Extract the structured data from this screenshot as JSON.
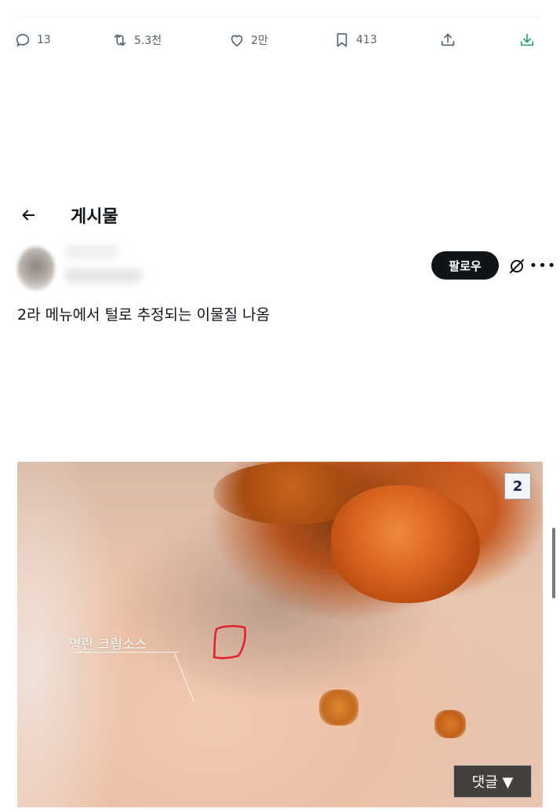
{
  "actions": {
    "reply_count": "13",
    "repost_count": "5.3천",
    "like_count": "2만",
    "bookmark_count": "413"
  },
  "header": {
    "title": "게시물"
  },
  "follow_label": "팔로우",
  "post": {
    "text": "2라 메뉴에서 털로 추정되는 이물질 나옴"
  },
  "image": {
    "badge": "2",
    "label": "명란 크림소스",
    "comment_button": "댓글 ▼"
  },
  "colors": {
    "follow_bg": "#0f1419",
    "icon_gray": "#536471",
    "download_green": "#2a9d74",
    "marker_red": "#e0222e"
  }
}
